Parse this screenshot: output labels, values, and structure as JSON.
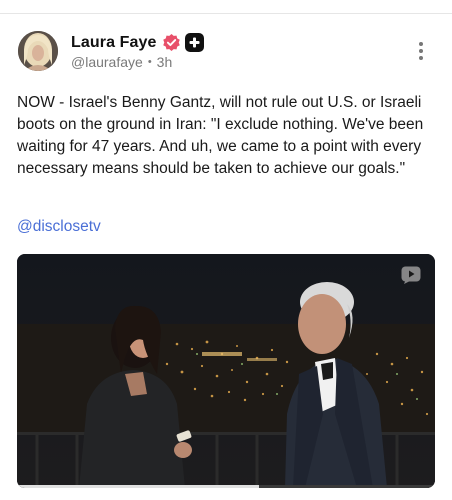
{
  "post": {
    "author_name": "Laura Faye",
    "handle": "@laurafaye",
    "time": "3h",
    "separator": "•",
    "text": "NOW - Israel's Benny Gantz, will not rule out U.S. or Israeli boots on the ground in Iran: \"I exclude nothing. We've been waiting for 47 years. And uh, we came to a point with every necessary means should be taken to achieve our goals.\"",
    "mention": "@disclosetv"
  },
  "icons": {
    "verified": "verified-badge-icon",
    "plus": "plus-badge-icon",
    "more": "more-vertical-icon",
    "video": "video-play-icon"
  },
  "colors": {
    "verified_badge": "#e8506a",
    "mention_link": "#4a6fd6",
    "meta_text": "#7a7a7a"
  },
  "video": {
    "progress_fraction": 0.58
  }
}
